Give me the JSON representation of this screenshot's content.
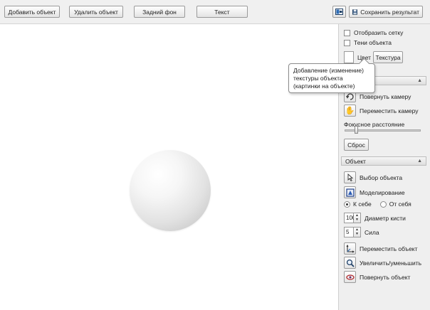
{
  "toolbar": {
    "add_object": "Добавить объект",
    "delete_object": "Удалить объект",
    "background": "Задний фон",
    "text": "Текст",
    "save_result": "Сохранить результат"
  },
  "panel": {
    "show_grid": "Отобразить сетку",
    "object_shadows": "Тени объекта",
    "color": "Цвет",
    "texture": "Текстура",
    "rotate_camera": "Повернуть камеру",
    "move_camera": "Переместить камеру",
    "focal_length": "Фокусное расстояние",
    "reset": "Сброс",
    "object_section": "Объект",
    "select_object": "Выбор объекта",
    "modeling": "Моделирование",
    "toward_self": "К себе",
    "away_self": "От себя",
    "brush_diameter_value": "100",
    "brush_diameter_label": "Диаметр кисти",
    "strength_value": "5",
    "strength_label": "Сила",
    "move_object": "Переместить объект",
    "scale_object": "Увеличить/уменьшить",
    "rotate_object": "Повернуть объект"
  },
  "tooltip": {
    "text": "Добавление (изменение) текстуры объекта (картинки на объекте)"
  },
  "icons": {
    "save": "save-icon",
    "rotate_camera": "rotate-camera-icon",
    "move_camera": "hand-icon",
    "select_object": "cursor-arrow-icon",
    "modeling": "modeling-icon",
    "move_object": "axes-move-icon",
    "scale_object": "magnifier-icon",
    "rotate_object": "rotate-object-icon",
    "collapse": "collapse-icon"
  },
  "colors": {
    "panel_bg": "#efefef",
    "toolbar_bg": "#f0f0f0",
    "accent_blue": "#2c6bb5",
    "rotate_red": "#b2292c"
  }
}
